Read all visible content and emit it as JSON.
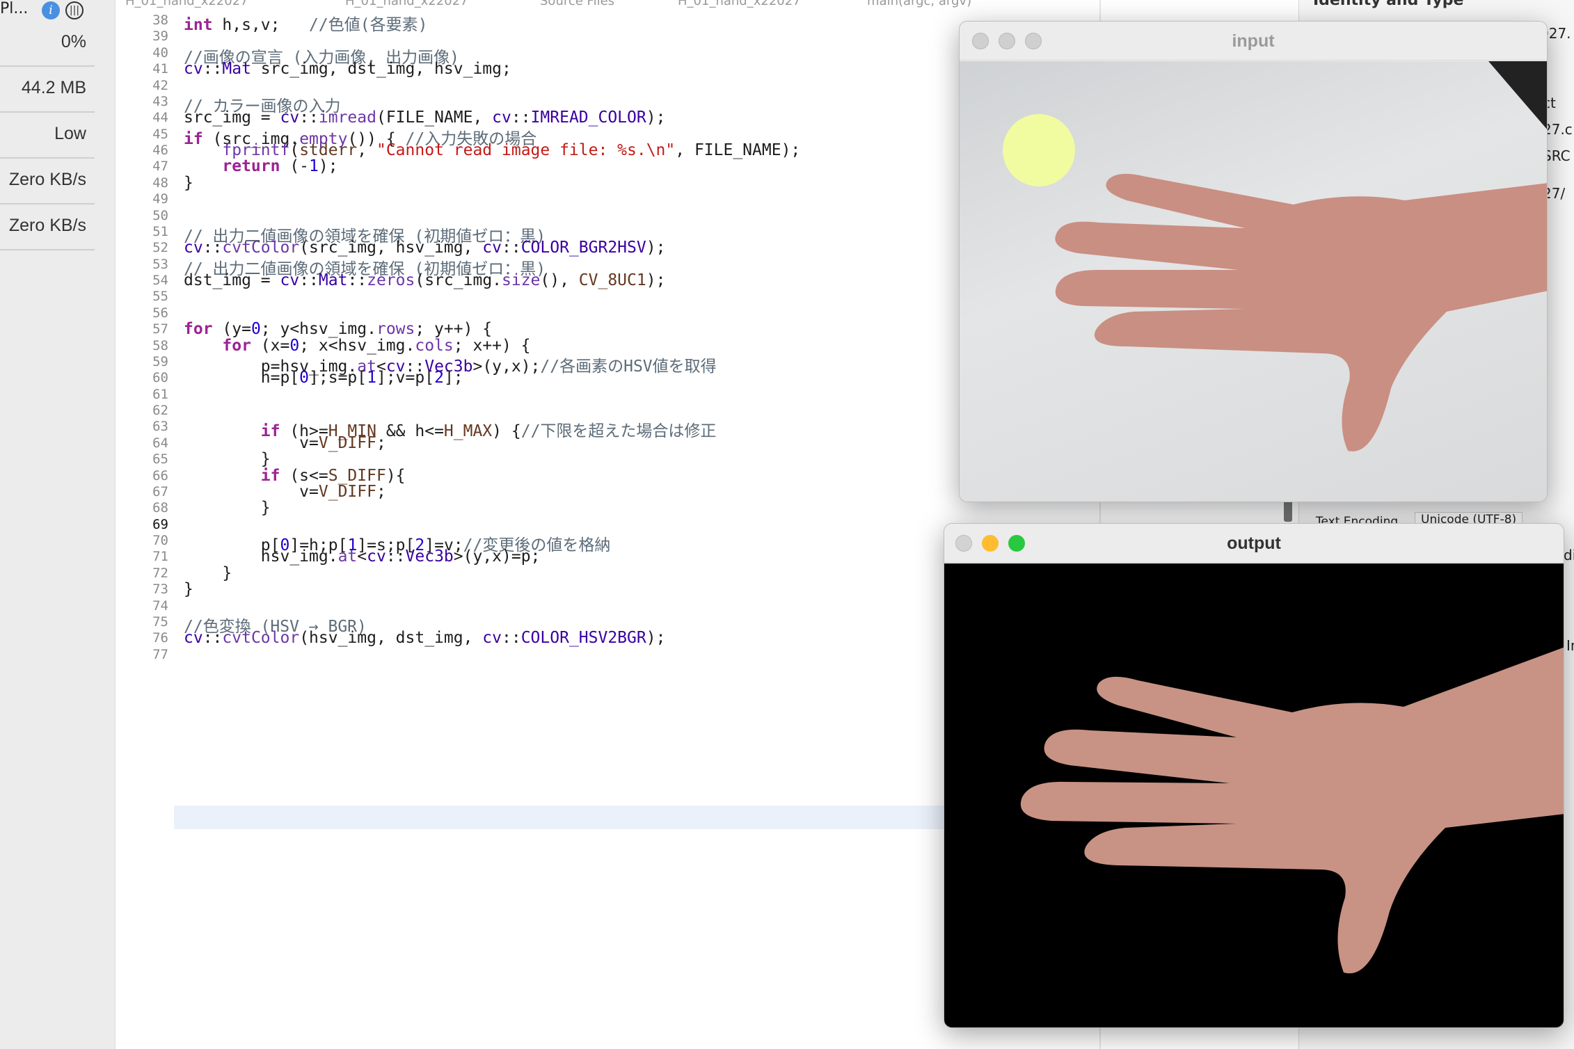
{
  "gauges": {
    "process": "Pl...",
    "cpu": "0%",
    "memory": "44.2 MB",
    "energy": "Low",
    "disk": "Zero KB/s",
    "network": "Zero KB/s"
  },
  "breadcrumb": [
    "H_01_hand_x22027",
    "H_01_hand_x22027",
    "Source Files",
    "H_01_hand_x22027",
    "main(argc, argv)"
  ],
  "editor": {
    "current_line": "69",
    "lines": [
      {
        "n": "38",
        "html": "<span class='kw'>int</span> h,s,v;   <span class='cm'>//色値(各要素)</span>"
      },
      {
        "n": "39",
        "html": ""
      },
      {
        "n": "40",
        "html": "<span class='cm'>//画像の宣言 (入力画像, 出力画像)</span>"
      },
      {
        "n": "41",
        "html": "<span class='ty'>cv</span>::<span class='ty'>Mat</span> src_img, dst_img, hsv_img;"
      },
      {
        "n": "42",
        "html": ""
      },
      {
        "n": "43",
        "html": "<span class='cm'>// カラー画像の入力</span>"
      },
      {
        "n": "44",
        "html": "src_img = <span class='ty'>cv</span>::<span class='fn'>imread</span>(FILE_NAME, <span class='ty'>cv</span>::<span class='ty'>IMREAD_COLOR</span>);"
      },
      {
        "n": "45",
        "html": "<span class='kw'>if</span> (src_img.<span class='fn'>empty</span>()) { <span class='cm'>//入力失敗の場合</span>"
      },
      {
        "n": "46",
        "html": "    <span class='fn'>fprintf</span>(<span class='mc'>stderr</span>, <span class='st'>\"Cannot read image file: %s.\\n\"</span>, FILE_NAME);"
      },
      {
        "n": "47",
        "html": "    <span class='kw'>return</span> (-<span class='nm'>1</span>);"
      },
      {
        "n": "48",
        "html": "}"
      },
      {
        "n": "49",
        "html": ""
      },
      {
        "n": "50",
        "html": ""
      },
      {
        "n": "51",
        "html": "<span class='cm'>// 出力二値画像の領域を確保 (初期値ゼロ：黒)</span>"
      },
      {
        "n": "52",
        "html": "<span class='ty'>cv</span>::<span class='fn'>cvtColor</span>(src_img, hsv_img, <span class='ty'>cv</span>::<span class='ty'>COLOR_BGR2HSV</span>);"
      },
      {
        "n": "53",
        "html": "<span class='cm'>// 出力二値画像の領域を確保 (初期値ゼロ：黒)</span>"
      },
      {
        "n": "54",
        "html": "dst_img = <span class='ty'>cv</span>::<span class='ty'>Mat</span>::<span class='fn'>zeros</span>(src_img.<span class='fn'>size</span>(), <span class='mc'>CV_8UC1</span>);"
      },
      {
        "n": "55",
        "html": ""
      },
      {
        "n": "56",
        "html": ""
      },
      {
        "n": "57",
        "html": "<span class='kw'>for</span> (y=<span class='nm'>0</span>; y&lt;hsv_img.<span class='fn'>rows</span>; y++) {"
      },
      {
        "n": "58",
        "html": "    <span class='kw'>for</span> (x=<span class='nm'>0</span>; x&lt;hsv_img.<span class='fn'>cols</span>; x++) {"
      },
      {
        "n": "59",
        "html": "        p=hsv_img.<span class='fn'>at</span>&lt;<span class='ty'>cv</span>::<span class='ty'>Vec3b</span>&gt;(y,x);<span class='cm'>//各画素のHSV値を取得</span>"
      },
      {
        "n": "60",
        "html": "        h=p[<span class='nm'>0</span>];s=p[<span class='nm'>1</span>];v=p[<span class='nm'>2</span>];"
      },
      {
        "n": "61",
        "html": ""
      },
      {
        "n": "62",
        "html": ""
      },
      {
        "n": "63",
        "html": "        <span class='kw'>if</span> (h&gt;=<span class='mc'>H_MIN</span> &amp;&amp; h&lt;=<span class='mc'>H_MAX</span>) {<span class='cm'>//下限を超えた場合は修正</span>"
      },
      {
        "n": "64",
        "html": "            v=<span class='mc'>V_DIFF</span>;"
      },
      {
        "n": "65",
        "html": "        }"
      },
      {
        "n": "66",
        "html": "        <span class='kw'>if</span> (s&lt;=<span class='mc'>S_DIFF</span>){"
      },
      {
        "n": "67",
        "html": "            v=<span class='mc'>V_DIFF</span>;"
      },
      {
        "n": "68",
        "html": "        }"
      },
      {
        "n": "69",
        "html": ""
      },
      {
        "n": "70",
        "html": "        p[<span class='nm'>0</span>]=h;p[<span class='nm'>1</span>]=s;p[<span class='nm'>2</span>]=v;<span class='cm'>//変更後の値を格納</span>"
      },
      {
        "n": "71",
        "html": "        hsv_img.<span class='fn'>at</span>&lt;<span class='ty'>cv</span>::<span class='ty'>Vec3b</span>&gt;(y,x)=p;"
      },
      {
        "n": "72",
        "html": "    }"
      },
      {
        "n": "73",
        "html": "}"
      },
      {
        "n": "74",
        "html": ""
      },
      {
        "n": "75",
        "html": "<span class='cm'>//色変換 (HSV → BGR)</span>"
      },
      {
        "n": "76",
        "html": "<span class='ty'>cv</span>::<span class='fn'>cvtColor</span>(hsv_img, dst_img, <span class='ty'>cv</span>::<span class='ty'>COLOR_HSV2BGR</span>);"
      },
      {
        "n": "77",
        "html": ""
      }
    ]
  },
  "inspector": {
    "title": "Identity and Type",
    "cells": [
      "027.",
      "ct",
      "27.c",
      "SRC",
      "27/",
      "Text Encoding",
      "Unicode (UTF-8)",
      "di",
      "In"
    ]
  },
  "windows": {
    "input": {
      "title": "input"
    },
    "output": {
      "title": "output"
    }
  },
  "colors": {
    "traffic_close": "#ff5f57",
    "traffic_min": "#febc2e",
    "traffic_max": "#28c840",
    "current_line_bg": "#ebf1fb"
  }
}
